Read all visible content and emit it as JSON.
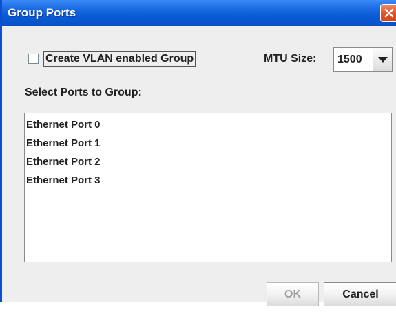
{
  "window": {
    "title": "Group Ports",
    "close_icon": "close-icon"
  },
  "options": {
    "vlan_checkbox_label": "Create VLAN enabled Group",
    "vlan_checked": false,
    "mtu_label": "MTU Size:",
    "mtu_value": "1500"
  },
  "ports": {
    "label": "Select Ports to Group:",
    "items": [
      {
        "label": "Ethernet Port 0"
      },
      {
        "label": "Ethernet Port 1"
      },
      {
        "label": "Ethernet Port 2"
      },
      {
        "label": "Ethernet Port 3"
      }
    ]
  },
  "buttons": {
    "ok_label": "OK",
    "ok_enabled": false,
    "cancel_label": "Cancel"
  },
  "colors": {
    "titlebar": "#0a5bd6",
    "close_button": "#e2552d",
    "dialog_background": "#eeeeee",
    "disabled_text": "#a0a0a0"
  }
}
